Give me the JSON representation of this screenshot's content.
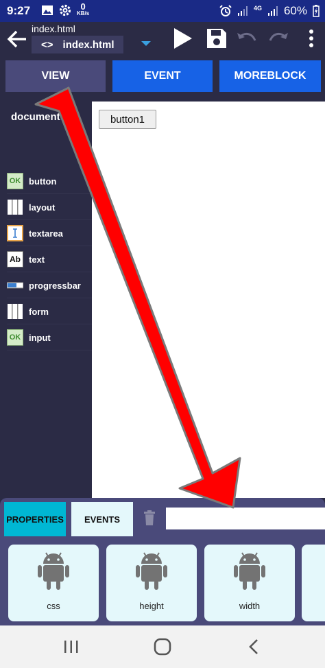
{
  "status_bar": {
    "time": "9:27",
    "net_speed_value": "0",
    "net_speed_unit": "KB/s",
    "network": "4G",
    "battery": "60%"
  },
  "toolbar": {
    "file_title": "index.html",
    "file_select": "index.html",
    "code_glyph": "<>"
  },
  "top_tabs": [
    {
      "label": "VIEW",
      "color": "#4a4a7a"
    },
    {
      "label": "EVENT",
      "color": "#1762e6"
    },
    {
      "label": "MOREBLOCK",
      "color": "#1762e6"
    }
  ],
  "left_panel": {
    "title": "document",
    "widgets": [
      {
        "label": "button",
        "icon": "ok-icon"
      },
      {
        "label": "layout",
        "icon": "layout-icon"
      },
      {
        "label": "textarea",
        "icon": "text-cursor-icon"
      },
      {
        "label": "text",
        "icon": "ab-icon"
      },
      {
        "label": "progressbar",
        "icon": "progressbar-icon"
      },
      {
        "label": "form",
        "icon": "layout-icon"
      },
      {
        "label": "input",
        "icon": "ok-icon"
      }
    ],
    "ok_text": "OK",
    "ab_text": "Ab"
  },
  "canvas": {
    "preview_button": "button1"
  },
  "bottom_panel": {
    "tabs": [
      {
        "label": "PROPERTIES",
        "color": "#00b7d4"
      },
      {
        "label": "EVENTS",
        "color": "#e4f8fb"
      }
    ],
    "properties": [
      {
        "label": "css"
      },
      {
        "label": "height"
      },
      {
        "label": "width"
      }
    ]
  },
  "colors": {
    "status_bar": "#1a2a86",
    "background": "#2b2b45",
    "accent_blue": "#1762e6",
    "arrow": "#ff0000",
    "card": "#e4f8fb",
    "android_gray": "#737373"
  }
}
